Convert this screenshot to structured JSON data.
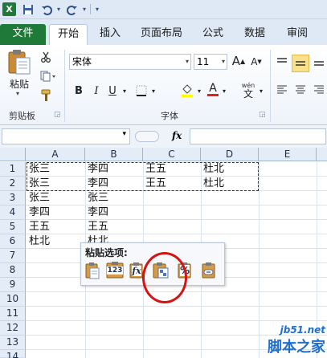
{
  "quick_access": {
    "app_icon": "X",
    "save_icon": "save-icon",
    "undo_icon": "undo-icon",
    "redo_icon": "redo-icon"
  },
  "tabs": [
    {
      "label": "文件"
    },
    {
      "label": "开始"
    },
    {
      "label": "插入"
    },
    {
      "label": "页面布局"
    },
    {
      "label": "公式"
    },
    {
      "label": "数据"
    },
    {
      "label": "审阅"
    }
  ],
  "ribbon": {
    "clipboard": {
      "paste_label": "粘贴",
      "group_label": "剪贴板"
    },
    "font": {
      "font_name": "宋体",
      "font_size": "11",
      "bold": "B",
      "italic": "I",
      "underline": "U",
      "grow": "A",
      "shrink": "A",
      "font_color": "A",
      "wen": "wén",
      "wen_char": "文",
      "group_label": "字体"
    }
  },
  "formula_bar": {
    "fx": "fx"
  },
  "sheet": {
    "columns": [
      "A",
      "B",
      "C",
      "D",
      "E"
    ],
    "rows": [
      "1",
      "2",
      "3",
      "4",
      "5",
      "6",
      "7",
      "8",
      "9",
      "10",
      "11",
      "12",
      "13",
      "14"
    ],
    "cells": {
      "A1": "张三",
      "B1": "李四",
      "C1": "王五",
      "D1": "杜北",
      "A2": "张三",
      "B2": "李四",
      "C2": "王五",
      "D2": "杜北",
      "A3": "张三",
      "B3": "张三",
      "A4": "李四",
      "B4": "李四",
      "A5": "王五",
      "B5": "王五",
      "A6": "杜北",
      "B6": "杜北"
    }
  },
  "paste_options": {
    "title": "粘贴选项:",
    "button_123": "123",
    "button_fx": "fx",
    "button_percent": "%"
  },
  "watermark": {
    "site": "jb51.net",
    "text": "脚本之家"
  },
  "colors": {
    "file_tab": "#1f7a3a",
    "highlight": "#fbe08a",
    "circle": "#d21414",
    "watermark": "#1f6fd1"
  }
}
